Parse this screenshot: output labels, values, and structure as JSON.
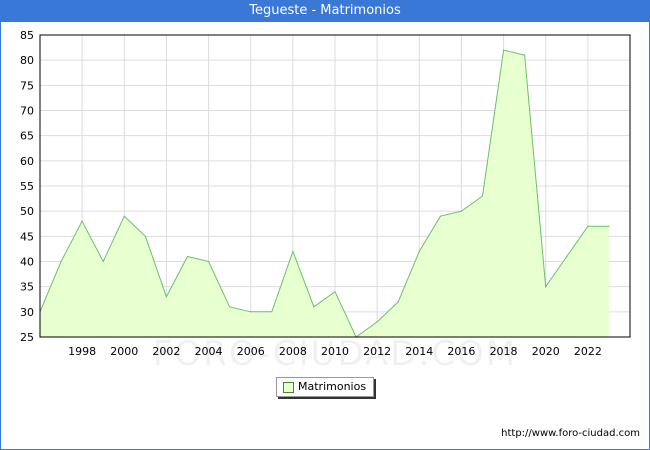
{
  "title": "Tegueste - Matrimonios",
  "source_url": "http://www.foro-ciudad.com",
  "watermark": "FORO-CIUDAD.COM",
  "colors": {
    "title_bar": "#3a78d8",
    "area_fill": "#e8ffd0",
    "area_line": "#6ac06a",
    "grid": "#dddddd"
  },
  "chart_data": {
    "type": "area",
    "title": "Tegueste - Matrimonios",
    "xlabel": "",
    "ylabel": "",
    "x_ticks": [
      1998,
      2000,
      2002,
      2004,
      2006,
      2008,
      2010,
      2012,
      2014,
      2016,
      2018,
      2020,
      2022
    ],
    "y_ticks": [
      25,
      30,
      35,
      40,
      45,
      50,
      55,
      60,
      65,
      70,
      75,
      80,
      85
    ],
    "xlim": [
      1996,
      2024
    ],
    "ylim": [
      25,
      85
    ],
    "grid": true,
    "legend_position": "bottom-center",
    "series": [
      {
        "name": "Matrimonios",
        "x": [
          1996,
          1997,
          1998,
          1999,
          2000,
          2001,
          2002,
          2003,
          2004,
          2005,
          2006,
          2007,
          2008,
          2009,
          2010,
          2011,
          2012,
          2013,
          2014,
          2015,
          2016,
          2017,
          2018,
          2019,
          2020,
          2021,
          2022,
          2023
        ],
        "values": [
          30,
          40,
          48,
          40,
          49,
          45,
          33,
          41,
          40,
          31,
          30,
          30,
          42,
          31,
          34,
          25,
          28,
          32,
          42,
          49,
          50,
          53,
          82,
          81,
          35,
          41,
          47,
          47
        ]
      }
    ]
  }
}
